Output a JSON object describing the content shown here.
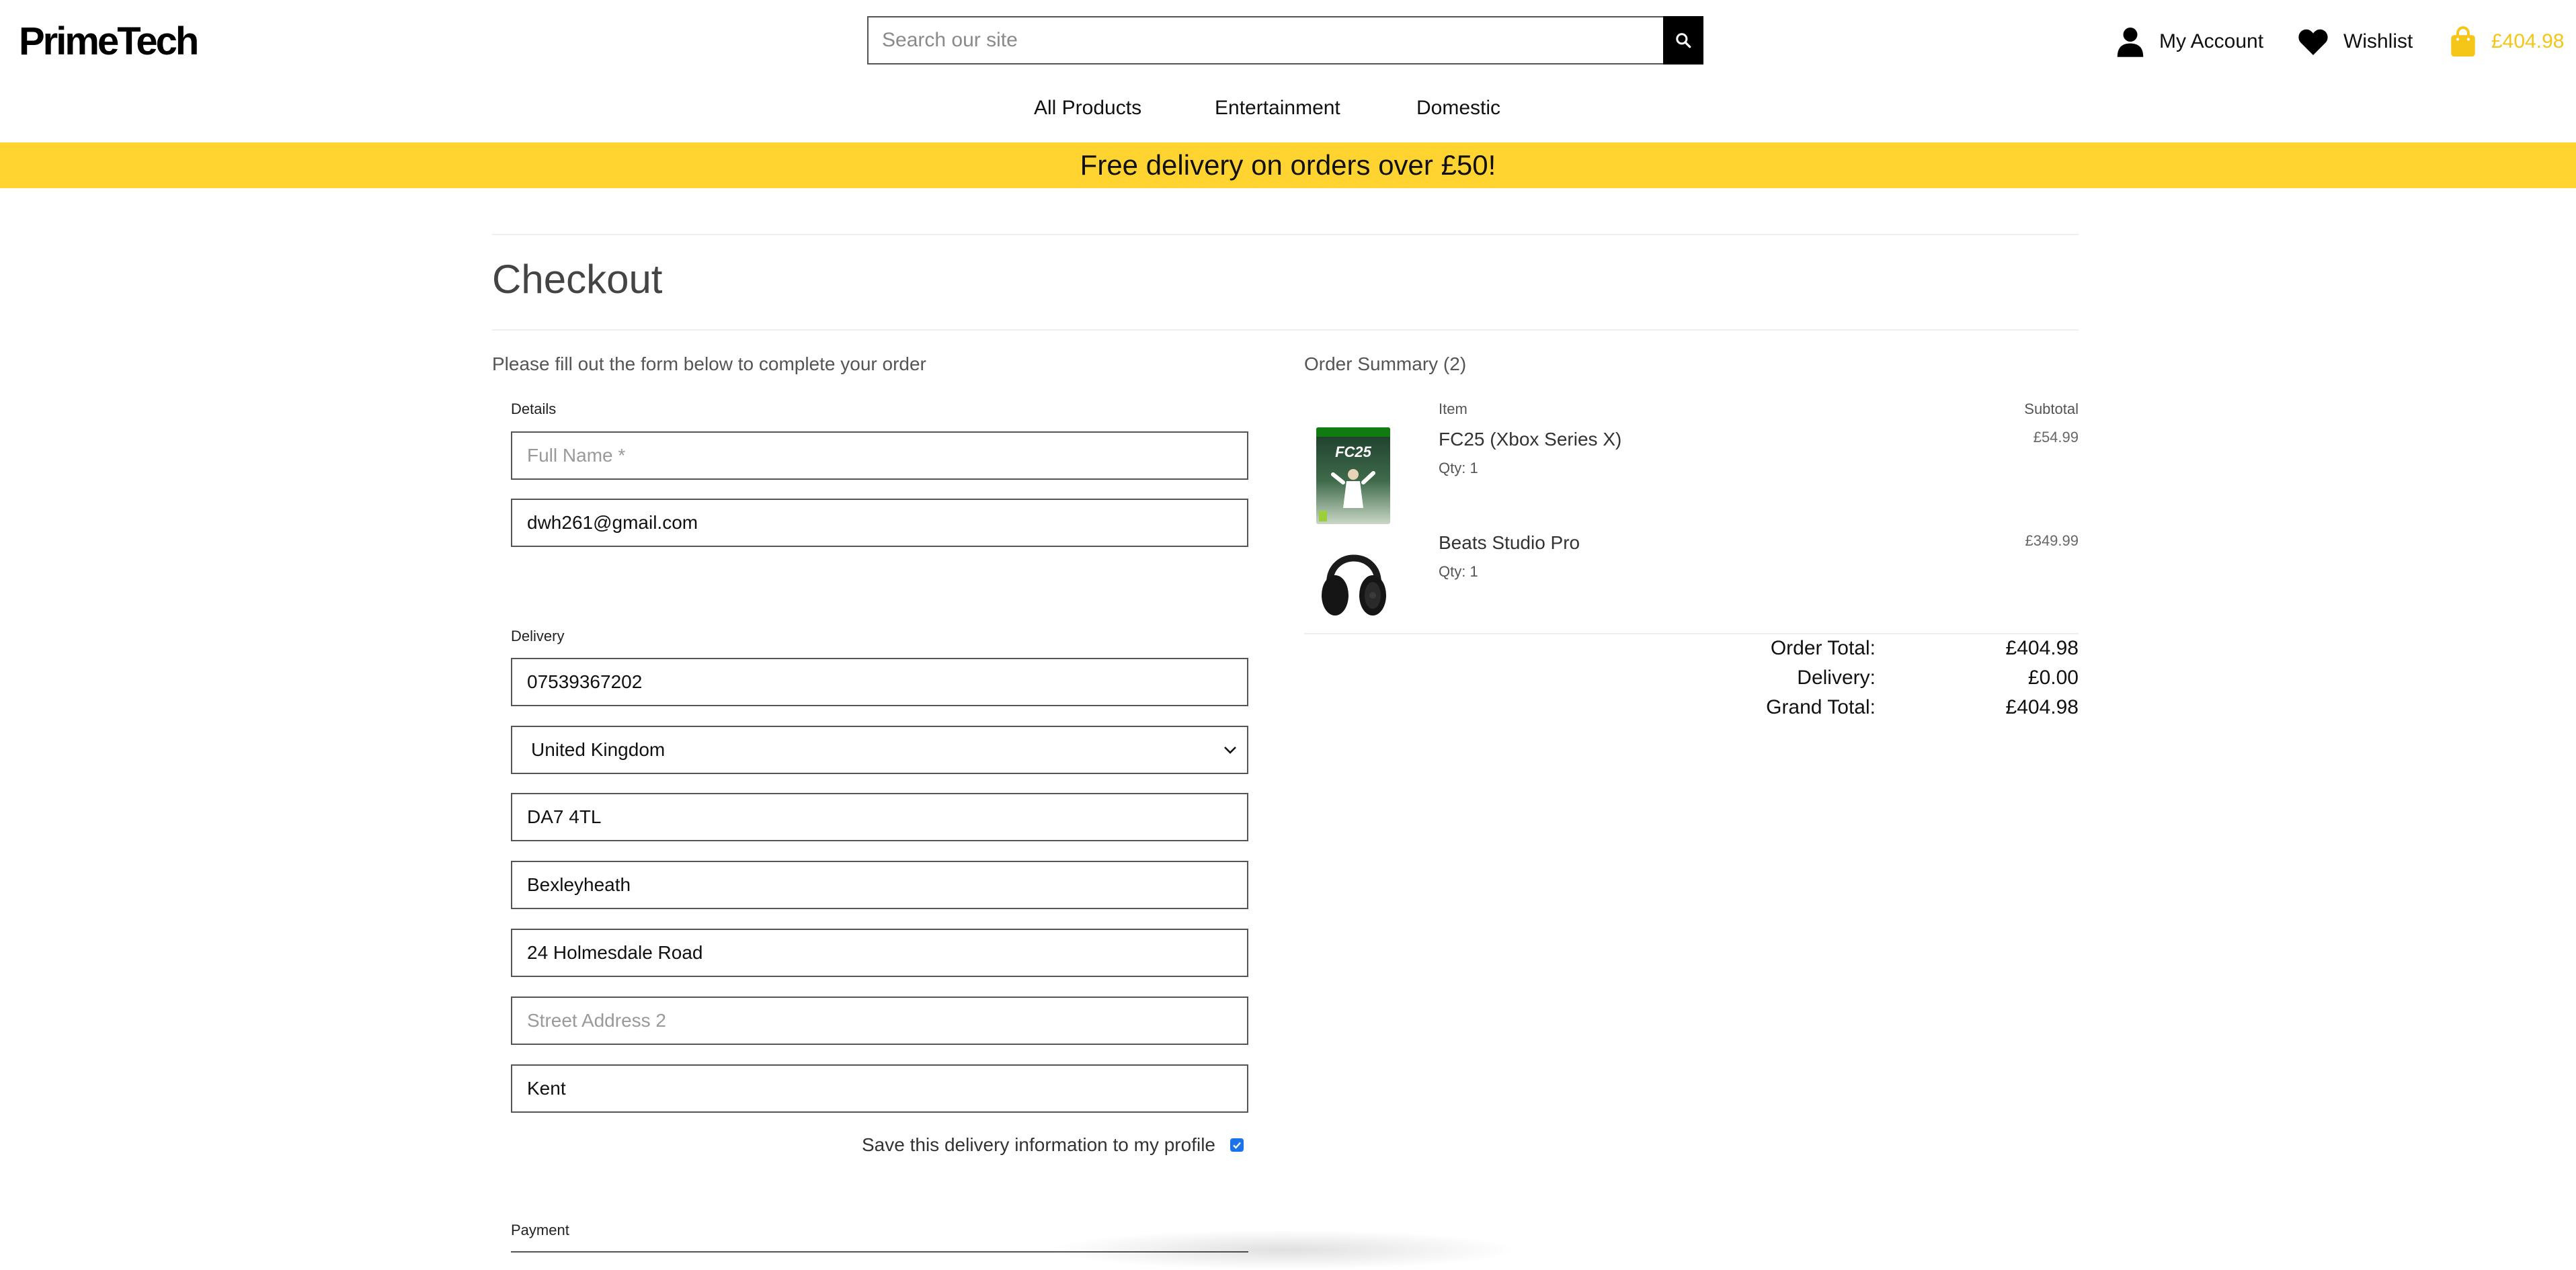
{
  "header": {
    "logo": "PrimeTech",
    "search_placeholder": "Search our site",
    "account_label": "My Account",
    "wishlist_label": "Wishlist",
    "bag_total": "£404.98"
  },
  "nav": {
    "items": [
      "All Products",
      "Entertainment",
      "Domestic"
    ]
  },
  "banner": {
    "text": "Free delivery on orders over £50!"
  },
  "checkout": {
    "title": "Checkout",
    "intro": "Please fill out the form below to complete your order",
    "details_label": "Details",
    "full_name_placeholder": "Full Name *",
    "email_value": "dwh261@gmail.com",
    "delivery_label": "Delivery",
    "phone_value": "07539367202",
    "country_value": "United Kingdom",
    "postcode_value": "DA7 4TL",
    "town_value": "Bexleyheath",
    "street1_value": "24 Holmesdale Road",
    "street2_placeholder": "Street Address 2",
    "county_value": "Kent",
    "save_info_label": "Save this delivery information to my profile",
    "save_info_checked": true,
    "payment_label": "Payment"
  },
  "summary": {
    "title": "Order Summary (2)",
    "col_item": "Item",
    "col_subtotal": "Subtotal",
    "items": [
      {
        "name": "FC25 (Xbox Series X)",
        "qty": "Qty: 1",
        "price": "£54.99",
        "image": "fc25-cover"
      },
      {
        "name": "Beats Studio Pro",
        "qty": "Qty: 1",
        "price": "£349.99",
        "image": "headphones"
      }
    ],
    "order_total_label": "Order Total:",
    "order_total": "£404.98",
    "delivery_label": "Delivery:",
    "delivery": "£0.00",
    "grand_total_label": "Grand Total:",
    "grand_total": "£404.98"
  },
  "colors": {
    "brand_yellow": "#ffd431",
    "bag_yellow": "#f5c518",
    "checkbox_blue": "#1a73e8"
  },
  "icons": [
    "search-icon",
    "user-icon",
    "heart-icon",
    "bag-icon",
    "chevron-down-icon",
    "check-icon"
  ]
}
